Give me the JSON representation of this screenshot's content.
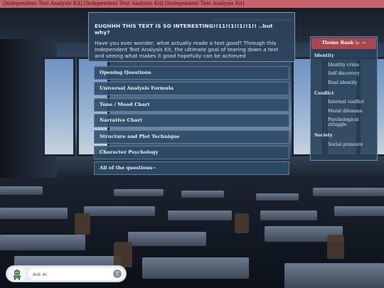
{
  "topbar": {
    "text": "[Independent Text Analysis Kit] [Independent Text Analysis Kit] [Independent Text Analysis Kit]"
  },
  "intro": {
    "title": "EUGHHH THIS TEXT IS SO INTERESTING!!11!!1!!1!!1!! ..but why?",
    "body_1": "Have you ever wonder, what actually made a text ",
    "body_em": "good",
    "body_2": "? Through this Independent Text Analysis Kit, the ultimate goal of tearing down a text and seeing what makes it good hopefully can be achieved"
  },
  "menu": {
    "items": [
      {
        "label": "Opening Questions"
      },
      {
        "label": "Universal Analysis Formula"
      },
      {
        "label": "Tone / Mood Chart"
      },
      {
        "label": "Narrative Chart"
      },
      {
        "label": "Structure and Plot Technique"
      },
      {
        "label": "Character Psychology"
      },
      {
        "label": "All of the questions~"
      }
    ]
  },
  "theme_bank": {
    "title": "Theme Bank 🎏 ~",
    "groups": [
      {
        "label": "Identity",
        "items": [
          "Identity crisis",
          "Self discovery",
          "Dual identity"
        ]
      },
      {
        "label": "Conflict",
        "items": [
          "Internal conflict",
          "Moral dilemma",
          "Psychological struggle"
        ]
      },
      {
        "label": "Society",
        "items": [
          "Social pressure"
        ]
      }
    ]
  },
  "ask": {
    "placeholder": "Ask AI",
    "send_icon": "arrow-up-icon",
    "avatar_icon": "robot-avatar-icon"
  },
  "colors": {
    "topbar": "#c9636b",
    "theme_header": "#a8474f",
    "panel": "#2c4a66"
  }
}
